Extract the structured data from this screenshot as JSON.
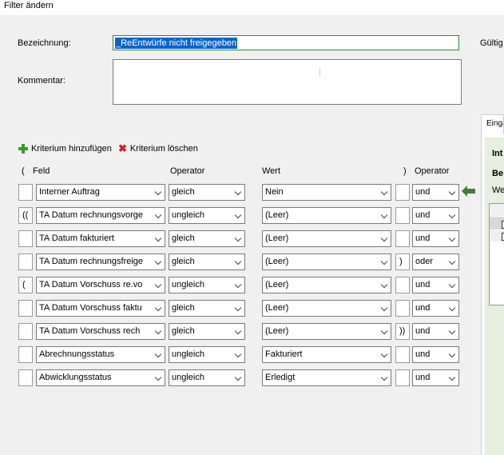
{
  "window": {
    "title": "Filter ändern"
  },
  "form": {
    "name_label": "Bezeichnung:",
    "name_value": "_ReEntwürfe nicht freigegeben",
    "comment_label": "Kommentar:",
    "comment_value": "",
    "valid_label": "Gültig"
  },
  "toolbar": {
    "add_label": "Kriterium hinzufügen",
    "delete_label": "Kriterium löschen"
  },
  "columns": {
    "open_paren": "(",
    "field": "Feld",
    "operator": "Operator",
    "value": "Wert",
    "close_paren": ")",
    "logic": "Operator"
  },
  "criteria": [
    {
      "open": "",
      "field": "Interner Auftrag",
      "op": "gleich",
      "value": "Nein",
      "close": "",
      "logic": "und"
    },
    {
      "open": "((",
      "field": "TA Datum rechnungsvorge",
      "op": "ungleich",
      "value": "(Leer)",
      "close": "",
      "logic": "und"
    },
    {
      "open": "",
      "field": "TA Datum fakturiert",
      "op": "gleich",
      "value": "(Leer)",
      "close": "",
      "logic": "und"
    },
    {
      "open": "",
      "field": "TA Datum rechnungsfreige",
      "op": "gleich",
      "value": "(Leer)",
      "close": ")",
      "logic": "oder"
    },
    {
      "open": "(",
      "field": "TA Datum Vorschuss re.vo",
      "op": "ungleich",
      "value": "(Leer)",
      "close": "",
      "logic": "und"
    },
    {
      "open": "",
      "field": "TA Datum Vorschuss faktu",
      "op": "gleich",
      "value": "(Leer)",
      "close": "",
      "logic": "und"
    },
    {
      "open": "",
      "field": "TA Datum Vorschuss rech",
      "op": "gleich",
      "value": "(Leer)",
      "close": "))",
      "logic": "und"
    },
    {
      "open": "",
      "field": "Abrechnungsstatus",
      "op": "ungleich",
      "value": "Fakturiert",
      "close": "",
      "logic": "und"
    },
    {
      "open": "",
      "field": "Abwicklungsstatus",
      "op": "ungleich",
      "value": "Erledigt",
      "close": "",
      "logic": "und"
    }
  ],
  "right_panel": {
    "tab_label": "Einga",
    "text1": "Int",
    "text2": "Be",
    "text3": "We"
  },
  "icons": {
    "add": "plus-icon",
    "delete": "x-icon",
    "current_row": "arrow-left-icon"
  },
  "colors": {
    "selection": "#0a64c8",
    "focus_border": "#2a8a3a",
    "add_icon": "#3a9a2a",
    "delete_icon": "#d42020",
    "arrow": "#4a7a3a"
  }
}
